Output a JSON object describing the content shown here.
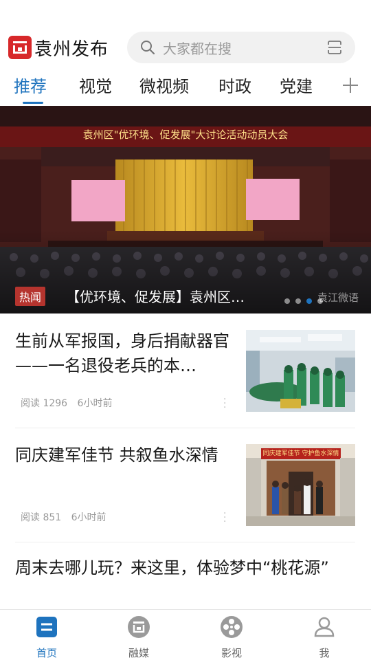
{
  "header": {
    "app_name": "袁州发布",
    "search_placeholder": "大家都在搜"
  },
  "tabs": [
    {
      "label": "推荐",
      "active": true
    },
    {
      "label": "视觉",
      "active": false
    },
    {
      "label": "微视频",
      "active": false
    },
    {
      "label": "时政",
      "active": false
    },
    {
      "label": "党建",
      "active": false
    }
  ],
  "banner": {
    "badge": "热闻",
    "title": "【优环境、促发展】袁州区…",
    "stage_banner": "袁州区\"优环境、促发展\"大讨论活动动员大会",
    "watermark": "袁江微语",
    "dots": 4,
    "active_dot": 3
  },
  "news": [
    {
      "title": "生前从军报国，身后捐献器官——一名退役老兵的本…",
      "read_label": "阅读",
      "reads": "1296",
      "time": "6小时前"
    },
    {
      "title": "同庆建军佳节 共叙鱼水深情",
      "read_label": "阅读",
      "reads": "851",
      "time": "6小时前",
      "image_sign": "同庆建军佳节 守护鱼水深情"
    },
    {
      "title": "周末去哪儿玩？来这里，体验梦中“桃花源”"
    }
  ],
  "bottom_nav": [
    {
      "label": "首页",
      "icon": "home-icon",
      "active": true
    },
    {
      "label": "融媒",
      "icon": "media-icon",
      "active": false
    },
    {
      "label": "影视",
      "icon": "film-reel-icon",
      "active": false
    },
    {
      "label": "我",
      "icon": "user-icon",
      "active": false
    }
  ],
  "colors": {
    "accent": "#1e73be",
    "brand_red": "#d7282a",
    "badge_red": "#b5342e"
  }
}
